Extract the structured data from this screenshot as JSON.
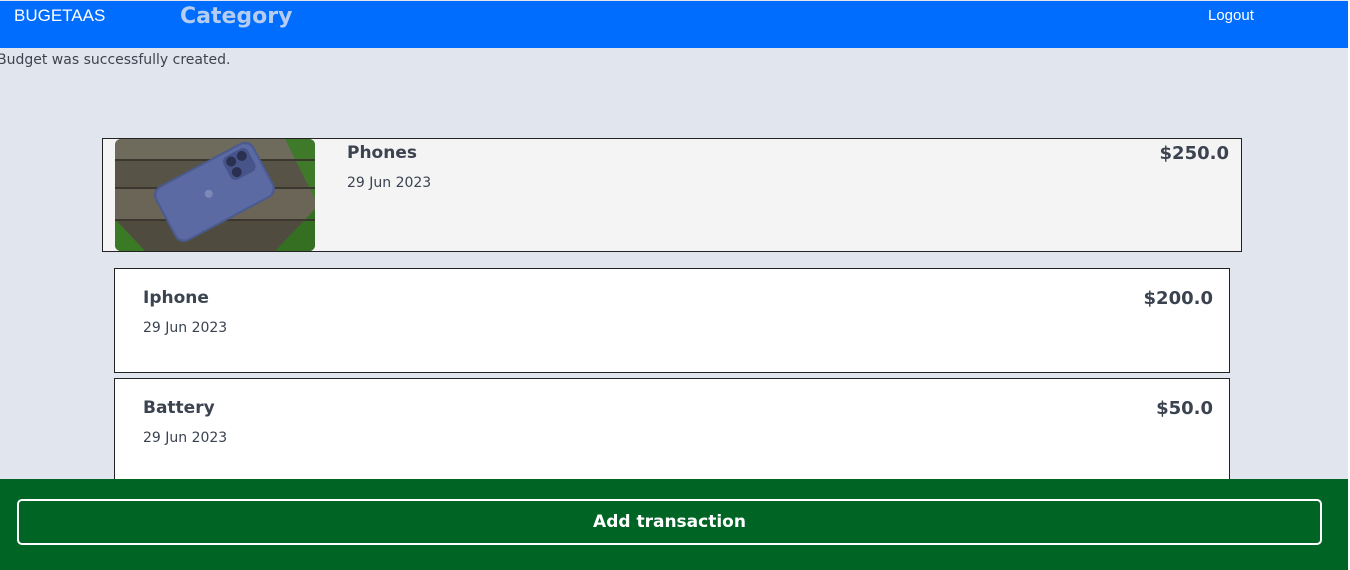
{
  "navbar": {
    "brand": "BUGETAAS",
    "title": "Category",
    "logout_label": "Logout",
    "background_color": "#006dff"
  },
  "flash": {
    "message": "Budget was successfully created."
  },
  "category": {
    "name": "Phones",
    "date": "29 Jun 2023",
    "amount": "$250.0",
    "image": "phone-on-wooden-bench-photo"
  },
  "transactions": [
    {
      "name": "Iphone",
      "date": "29 Jun 2023",
      "amount": "$200.0"
    },
    {
      "name": "Battery",
      "date": "29 Jun 2023",
      "amount": "$50.0"
    }
  ],
  "footer": {
    "add_label": "Add transaction",
    "background_color": "#006424"
  }
}
